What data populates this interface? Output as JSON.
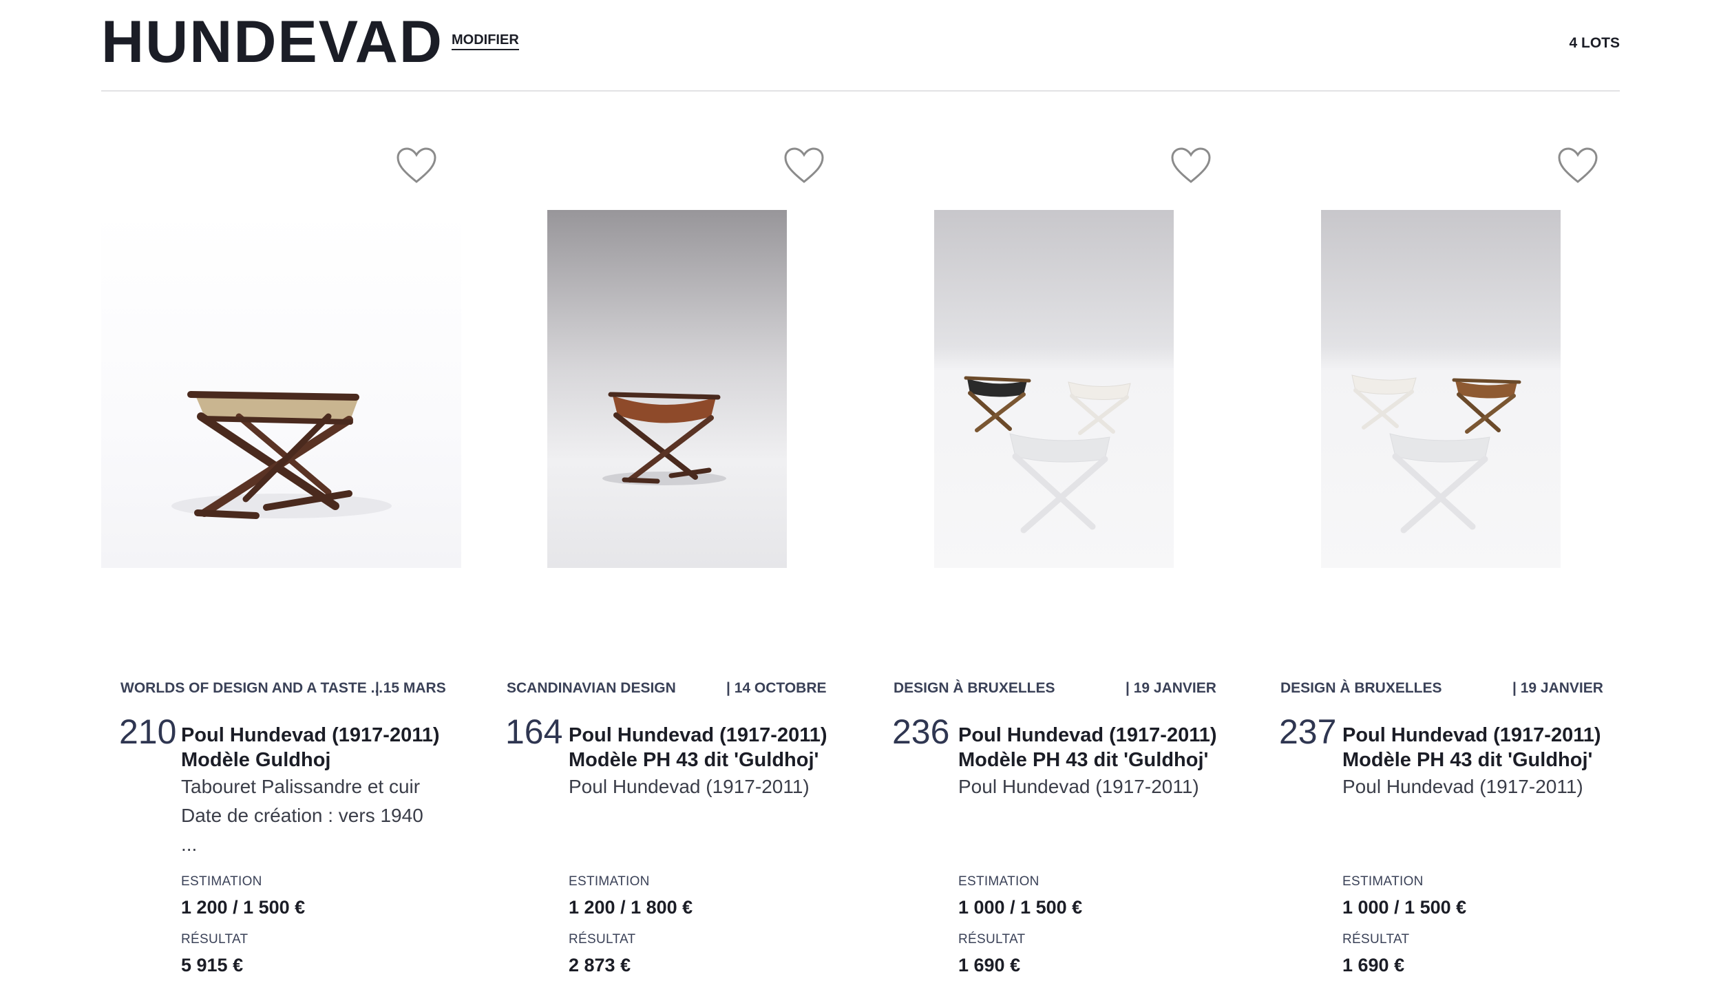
{
  "header": {
    "title": "HUNDEVAD",
    "modify_label": "MODIFIER",
    "lot_count": "4 LOTS"
  },
  "lots": [
    {
      "sale": "WORLDS OF DESIGN AND A TASTE ...",
      "date": "| 15 MARS",
      "number": "210",
      "title_line1": "Poul Hundevad (1917-2011)",
      "title_line2": "Modèle Guldhoj",
      "desc": [
        "Tabouret Palissandre et cuir",
        "Date de création : vers 1940",
        "..."
      ],
      "estimate_label": "ESTIMATION",
      "estimate": "1 200 / 1 500 €",
      "result_label": "RÉSULTAT",
      "result": "5 915 €"
    },
    {
      "sale": "SCANDINAVIAN DESIGN",
      "date": "| 14 OCTOBRE",
      "number": "164",
      "title_line1": "Poul Hundevad (1917-2011)",
      "title_line2": "Modèle PH 43 dit 'Guldhoj'",
      "desc": [
        "Poul Hundevad (1917-2011)"
      ],
      "estimate_label": "ESTIMATION",
      "estimate": "1 200 / 1 800 €",
      "result_label": "RÉSULTAT",
      "result": "2 873 €"
    },
    {
      "sale": "DESIGN À BRUXELLES",
      "date": "| 19 JANVIER",
      "number": "236",
      "title_line1": "Poul Hundevad (1917-2011)",
      "title_line2": "Modèle PH 43 dit 'Guldhoj'",
      "desc": [
        "Poul Hundevad (1917-2011)"
      ],
      "estimate_label": "ESTIMATION",
      "estimate": "1 000 / 1 500 €",
      "result_label": "RÉSULTAT",
      "result": "1 690 €"
    },
    {
      "sale": "DESIGN À BRUXELLES",
      "date": "| 19 JANVIER",
      "number": "237",
      "title_line1": "Poul Hundevad (1917-2011)",
      "title_line2": "Modèle PH 43 dit 'Guldhoj'",
      "desc": [
        "Poul Hundevad (1917-2011)"
      ],
      "estimate_label": "ESTIMATION",
      "estimate": "1 000 / 1 500 €",
      "result_label": "RÉSULTAT",
      "result": "1 690 €"
    }
  ],
  "icons": {
    "favorite": "heart-outline-icon"
  },
  "colors": {
    "text": "#1b1d26",
    "muted": "#3a4157",
    "rule": "#e2e2e4",
    "wood": "#5a3324",
    "leather": "#8e4a2a"
  }
}
